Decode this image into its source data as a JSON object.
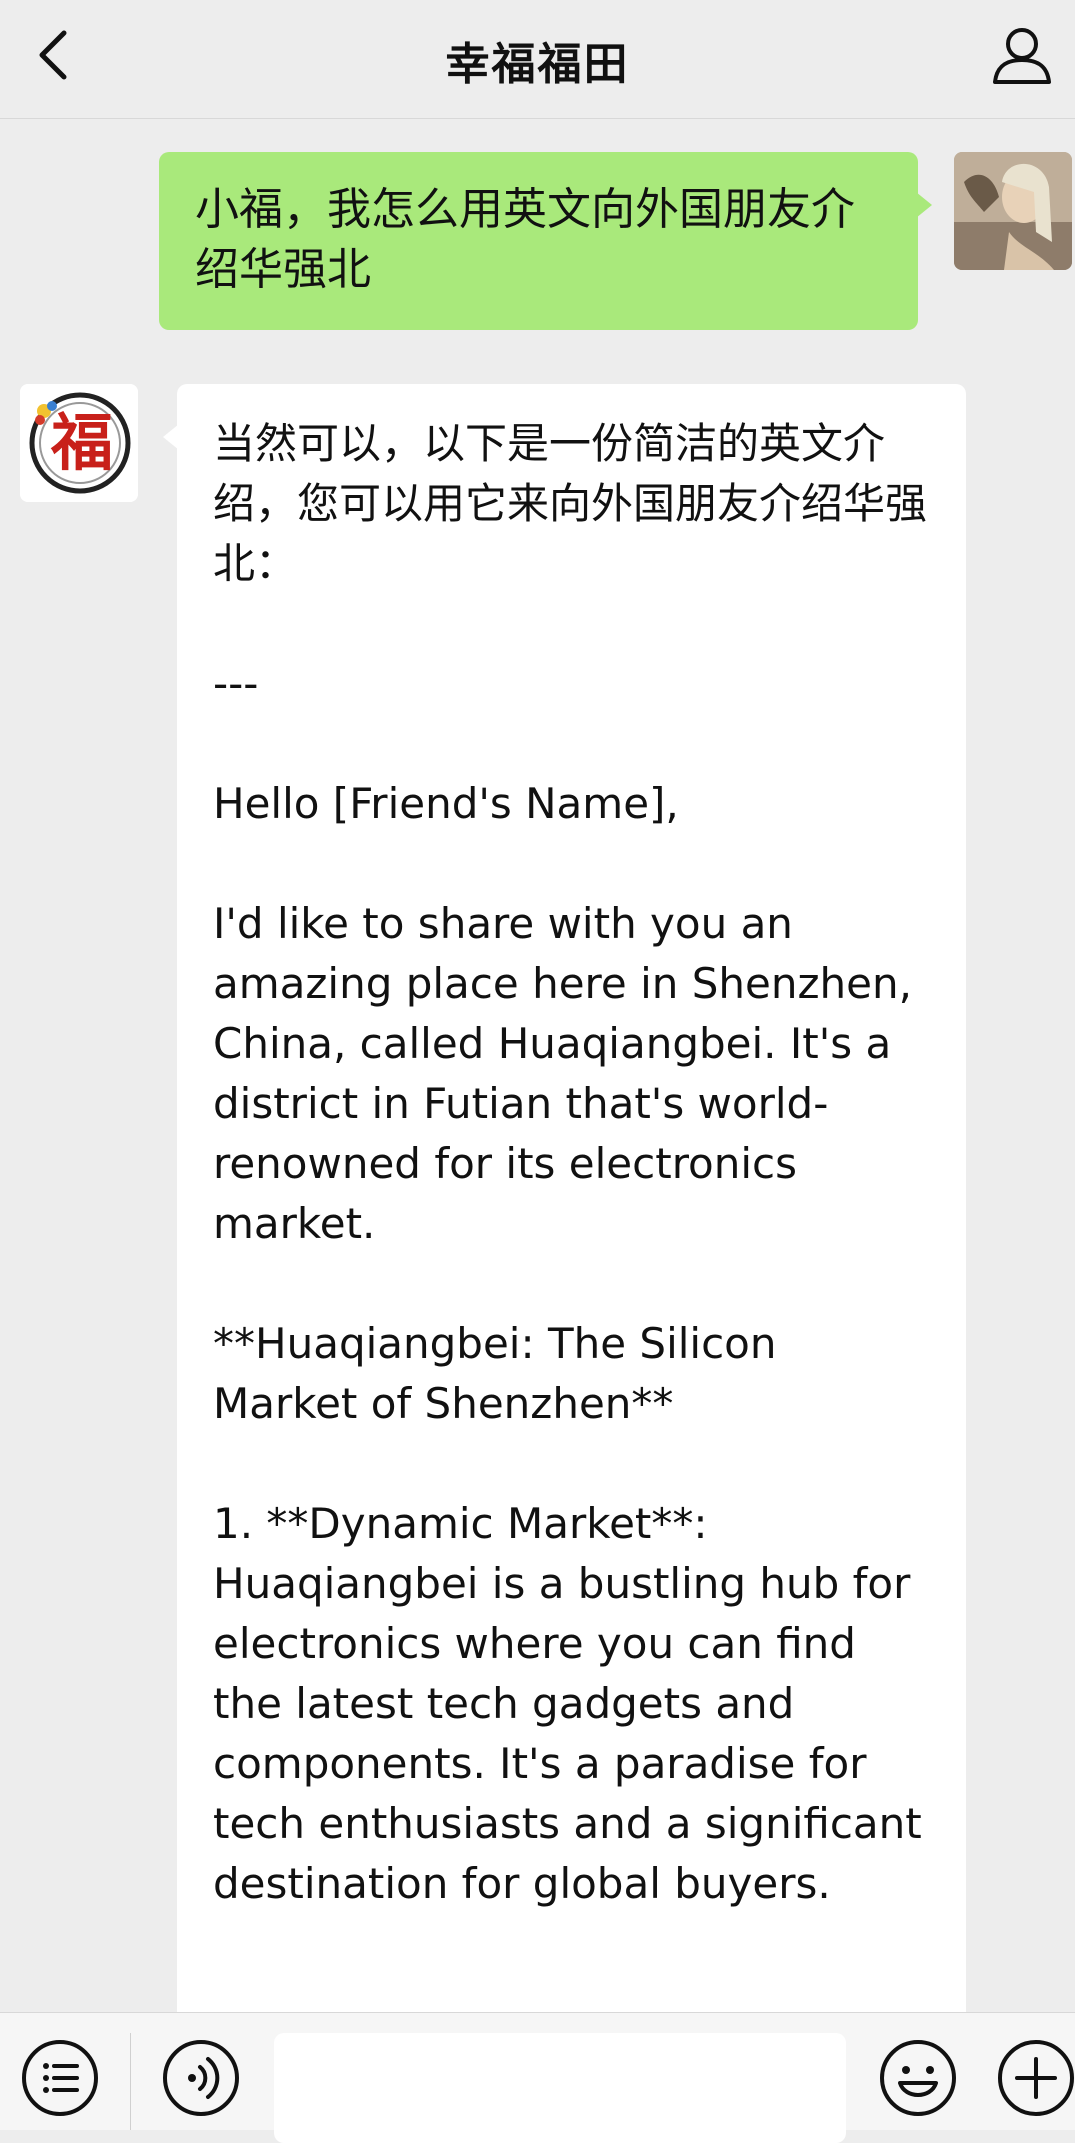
{
  "header": {
    "title": "幸福福田",
    "back_icon": "chevron-left-icon",
    "profile_icon": "person-outline-icon"
  },
  "messages": [
    {
      "sender": "user",
      "text": "小福，我怎么用英文向外国朋友介绍华强北"
    },
    {
      "sender": "bot",
      "text": "当然可以，以下是一份简洁的英文介绍，您可以用它来向外国朋友介绍华强北：\n\n---\n\nHello [Friend's Name],\n\nI'd like to share with you an amazing place here in Shenzhen, China, called Huaqiangbei. It's a district in Futian that's world-renowned for its electronics market.\n\n**Huaqiangbei: The Silicon Market of Shenzhen**\n\n1. **Dynamic Market**: Huaqiangbei is a bustling hub for electronics where you can find the latest tech gadgets and components. It's a paradise for tech enthusiasts and a significant destination for global buyers."
    }
  ],
  "bot_avatar_glyph": "福",
  "input": {
    "value": "",
    "menu_icon": "list-menu-icon",
    "voice_icon": "voice-icon",
    "emoji_icon": "smiley-icon",
    "plus_icon": "plus-icon"
  },
  "colors": {
    "user_bubble": "#a9e97b",
    "bot_bubble": "#ffffff",
    "background": "#ededed"
  }
}
